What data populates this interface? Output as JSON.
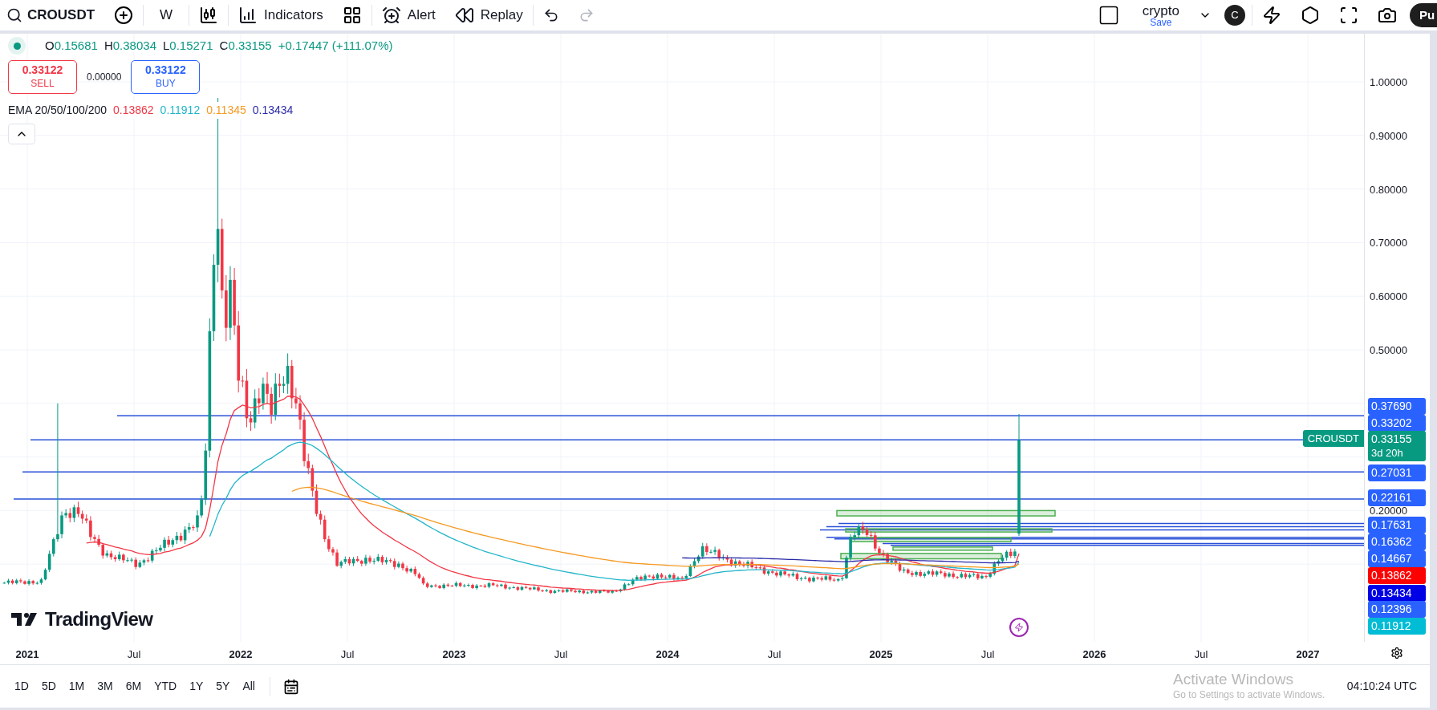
{
  "toolbar": {
    "symbol": "CROUSDT",
    "interval": "W",
    "indicators_label": "Indicators",
    "alert_label": "Alert",
    "replay_label": "Replay",
    "undo": {
      "disabled": false
    },
    "redo": {
      "disabled": true
    },
    "layout_name": "crypto",
    "save_label": "Save",
    "avatar_letter": "C",
    "publish_label": "Pu"
  },
  "legend": {
    "ohlc": [
      {
        "key": "O",
        "value": "0.15681"
      },
      {
        "key": "H",
        "value": "0.38034"
      },
      {
        "key": "L",
        "value": "0.15271"
      },
      {
        "key": "C",
        "value": "0.33155"
      }
    ],
    "change": "+0.17447 (+111.07%)",
    "sell": {
      "price": "0.33122",
      "label": "SELL"
    },
    "spread": "0.00000",
    "buy": {
      "price": "0.33122",
      "label": "BUY"
    },
    "indicator": {
      "name": "EMA 20/50/100/200",
      "values": [
        {
          "text": "0.13862",
          "color": "#f23645"
        },
        {
          "text": "0.11912",
          "color": "#22b5c9"
        },
        {
          "text": "0.11345",
          "color": "#f59a23"
        },
        {
          "text": "0.13434",
          "color": "#2a2aa8"
        }
      ]
    }
  },
  "price_axis": {
    "labels": [
      "1.00000",
      "0.90000",
      "0.80000",
      "0.70000",
      "0.60000",
      "0.50000",
      "0.20000"
    ],
    "tags": [
      {
        "kind": "price",
        "text": "0.37690",
        "color": "#2962ff"
      },
      {
        "kind": "price",
        "text": "0.33202",
        "color": "#2962ff"
      },
      {
        "kind": "last",
        "text": "0.33155",
        "countdown": "3d 20h",
        "symbol": "CROUSDT",
        "color": "#089981"
      },
      {
        "kind": "price",
        "text": "0.27031",
        "color": "#2962ff"
      },
      {
        "kind": "price",
        "text": "0.22161",
        "color": "#2962ff"
      },
      {
        "kind": "price",
        "text": "0.17631",
        "color": "#2962ff"
      },
      {
        "kind": "price",
        "text": "0.16362",
        "color": "#2962ff"
      },
      {
        "kind": "price",
        "text": "0.14667",
        "color": "#2962ff"
      },
      {
        "kind": "price",
        "text": "0.13862",
        "color": "#ff0000"
      },
      {
        "kind": "price",
        "text": "0.13434",
        "color": "#0000e6"
      },
      {
        "kind": "price",
        "text": "0.12396",
        "color": "#2962ff"
      },
      {
        "kind": "price",
        "text": "0.11912",
        "color": "#00bcd4"
      }
    ]
  },
  "time_axis": {
    "labels": [
      "2021",
      "Jul",
      "2022",
      "Jul",
      "2023",
      "Jul",
      "2024",
      "Jul",
      "2025",
      "Jul",
      "2026",
      "Jul",
      "2027"
    ]
  },
  "logo": "TradingView",
  "range_buttons": [
    "1D",
    "5D",
    "1M",
    "3M",
    "6M",
    "YTD",
    "1Y",
    "5Y",
    "All"
  ],
  "clock": "04:10:24 UTC",
  "os_notice": {
    "title": "Activate Windows",
    "subtitle": "Go to Settings to activate Windows."
  }
}
